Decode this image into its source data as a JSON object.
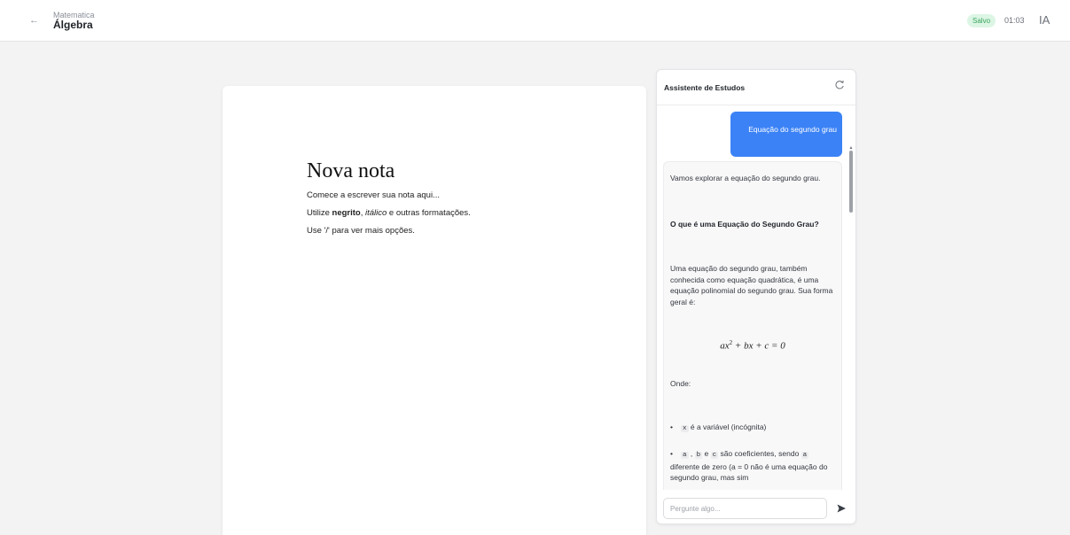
{
  "header": {
    "back_icon": "arrow-left-icon",
    "subject": "Matematica",
    "title": "Álgebra",
    "status": "Salvo",
    "status_color": "#3aa55d",
    "timer": "01:03",
    "ai_label": "IA"
  },
  "editor": {
    "title": "Nova nota",
    "line1": "Comece a escrever sua nota aqui...",
    "line2_prefix": "Utilize ",
    "line2_bold": "negrito",
    "line2_sep": ", ",
    "line2_italic": "itálico",
    "line2_suffix": " e outras formatações.",
    "line3": "Use '/' para ver mais opções."
  },
  "assistant": {
    "title": "Assistente de Estudos",
    "refresh_icon": "refresh-icon",
    "user_message": "Equação do segundo grau",
    "user_bubble_color": "#3b82f6",
    "bot": {
      "intro": "Vamos explorar a equação do segundo grau.",
      "heading": "O que é uma Equação do Segundo Grau?",
      "paragraph": "Uma equação do segundo grau, também conhecida como equação quadrática, é uma equação polinomial do segundo grau. Sua forma geral é:",
      "formula_a": "ax",
      "formula_exp": "2",
      "formula_rest": " + bx + c = 0",
      "onde": "Onde:",
      "item1_code": "x",
      "item1_text": " é a variável (incógnita)",
      "item2_code_a": "a",
      "item2_sep1": " , ",
      "item2_code_b": "b",
      "item2_sep2": " e ",
      "item2_code_c": "c",
      "item2_text1": " são coeficientes, sendo ",
      "item2_code_a2": "a",
      "item2_text2": " diferente de zero (a = 0 não é uma equação do segundo grau, mas sim"
    },
    "input_placeholder": "Pergunte algo...",
    "send_icon": "send-icon"
  }
}
